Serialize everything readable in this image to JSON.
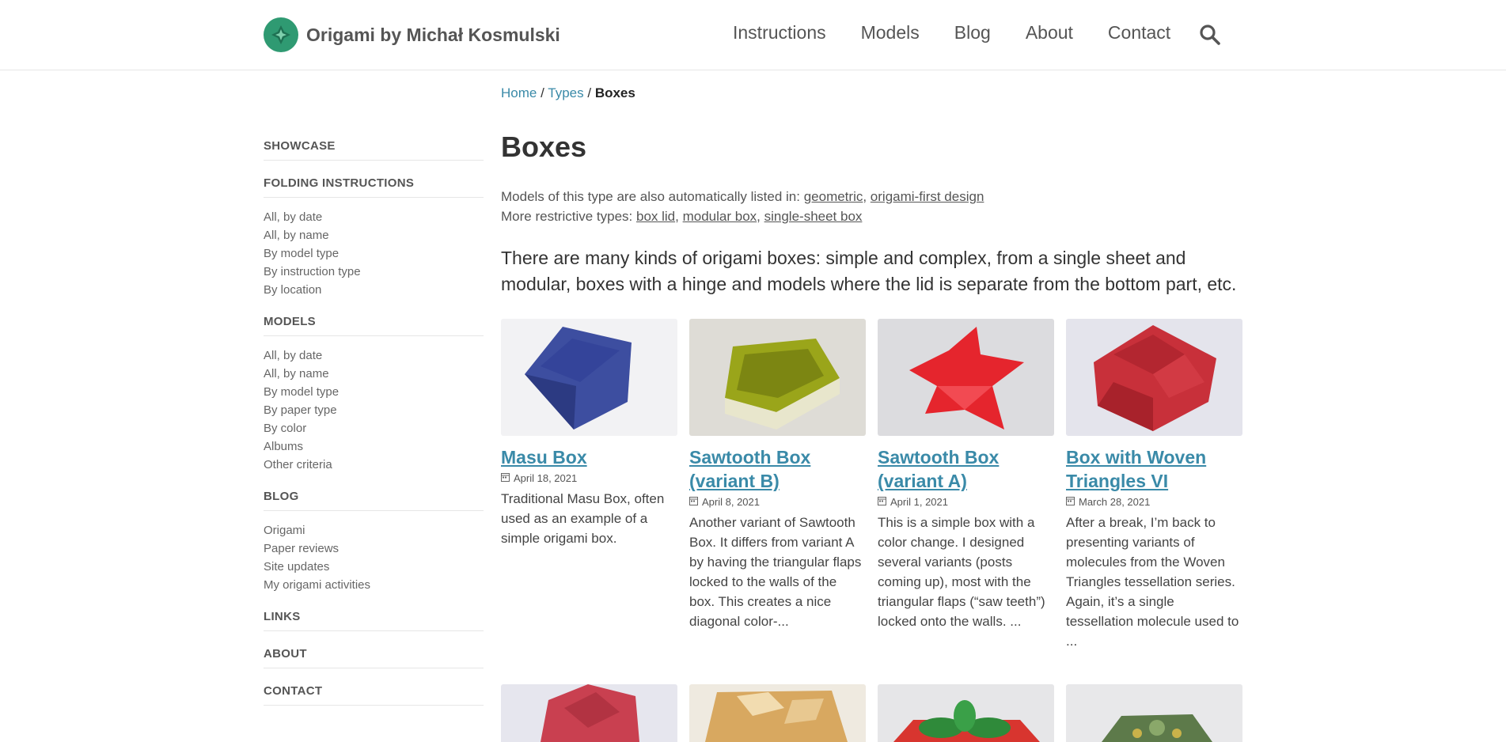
{
  "header": {
    "brand": "Origami by Michał Kosmulski",
    "nav": [
      "Instructions",
      "Models",
      "Blog",
      "About",
      "Contact"
    ],
    "search_icon": "search-icon"
  },
  "breadcrumb": {
    "home": "Home",
    "types": "Types",
    "current": "Boxes",
    "sep": "/"
  },
  "page": {
    "title": "Boxes",
    "also_listed_prefix": "Models of this type are also automatically listed in:",
    "also_listed": [
      "geometric",
      "origami-first design"
    ],
    "restrictive_prefix": "More restrictive types:",
    "restrictive": [
      "box lid",
      "modular box",
      "single-sheet box"
    ],
    "intro": "There are many kinds of origami boxes: simple and complex, from a single sheet and modular, boxes with a hinge and models where the lid is separate from the bottom part, etc."
  },
  "sidebar": {
    "showcase": "SHOWCASE",
    "folding": {
      "heading": "FOLDING INSTRUCTIONS",
      "items": [
        "All, by date",
        "All, by name",
        "By model type",
        "By instruction type",
        "By location"
      ]
    },
    "models": {
      "heading": "MODELS",
      "items": [
        "All, by date",
        "All, by name",
        "By model type",
        "By paper type",
        "By color",
        "Albums",
        "Other criteria"
      ]
    },
    "blog": {
      "heading": "BLOG",
      "items": [
        "Origami",
        "Paper reviews",
        "Site updates",
        "My origami activities"
      ]
    },
    "links": "LINKS",
    "about": "ABOUT",
    "contact": "CONTACT"
  },
  "cards": [
    {
      "title_1": "Masu Box",
      "title_2": "",
      "date": "April 18, 2021",
      "desc": "Traditional Masu Box, often used as an example of a simple origami box.",
      "color": "#3d4ea0"
    },
    {
      "title_1": "Sawtooth Box",
      "title_2": "(variant B)",
      "date": "April 8, 2021",
      "desc": "Another variant of Sawtooth Box. It differs from variant A by having the triangular flaps locked to the walls of the box. This creates a nice diagonal color-...",
      "color": "#9aa51a"
    },
    {
      "title_1": "Sawtooth Box",
      "title_2": "(variant A)",
      "date": "April 1, 2021",
      "desc": "This is a simple box with a color change. I designed several variants (posts coming up), most with the triangular flaps (“saw teeth”) locked onto the walls. ...",
      "color": "#e5252d"
    },
    {
      "title_1": "Box with Woven",
      "title_2": "Triangles VI",
      "date": "March 28, 2021",
      "desc": "After a break, I’m back to presenting variants of molecules from the Woven Triangles tessellation series. Again, it’s a single tessellation molecule used to ...",
      "color": "#c8303a"
    }
  ],
  "row2_colors": [
    "#c94050",
    "#d8a860",
    "#2f8a3a",
    "#5d7a4a"
  ]
}
